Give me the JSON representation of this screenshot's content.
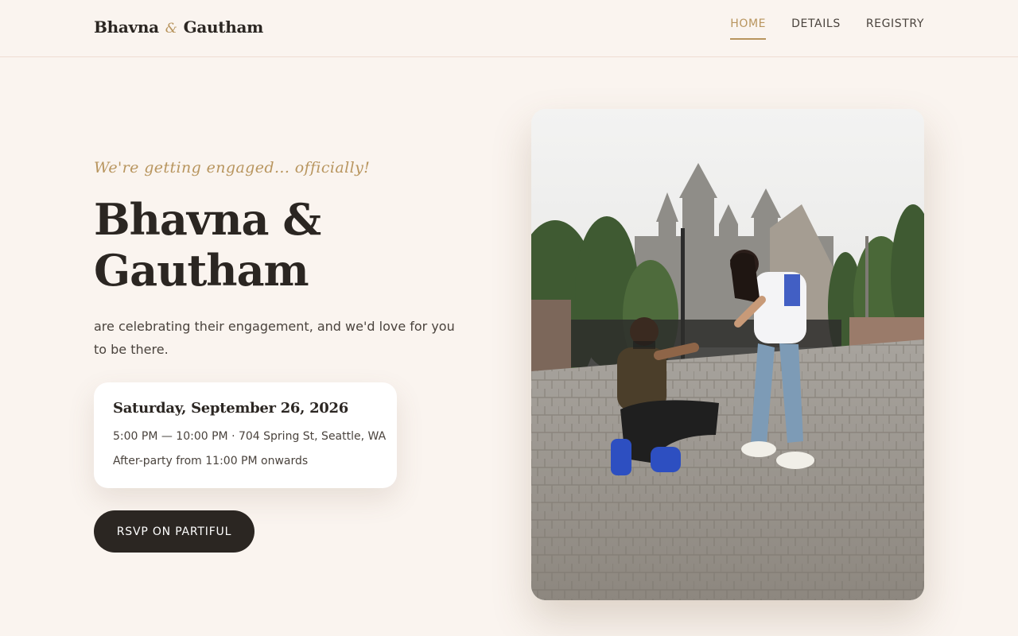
{
  "header": {
    "logo": {
      "first": "Bhavna",
      "amp": "&",
      "second": "Gautham"
    },
    "nav": [
      {
        "label": "HOME",
        "active": true
      },
      {
        "label": "DETAILS",
        "active": false
      },
      {
        "label": "REGISTRY",
        "active": false
      }
    ]
  },
  "hero": {
    "tagline": "We're getting engaged... officially!",
    "names": "Bhavna & Gautham",
    "subtext": "are celebrating their engagement, and we'd love for you to be there.",
    "event": {
      "date": "Saturday, September 26, 2026",
      "time_location": "5:00 PM — 10:00 PM · 704 Spring St, Seattle, WA",
      "after_party": "After-party from 11:00 PM onwards"
    },
    "rsvp_label": "RSVP ON PARTIFUL"
  },
  "photo": {
    "icon": "engagement-photo"
  },
  "colors": {
    "background": "#faf4ef",
    "accent_gold": "#b8955e",
    "dark": "#2b2622",
    "card": "#ffffff"
  }
}
